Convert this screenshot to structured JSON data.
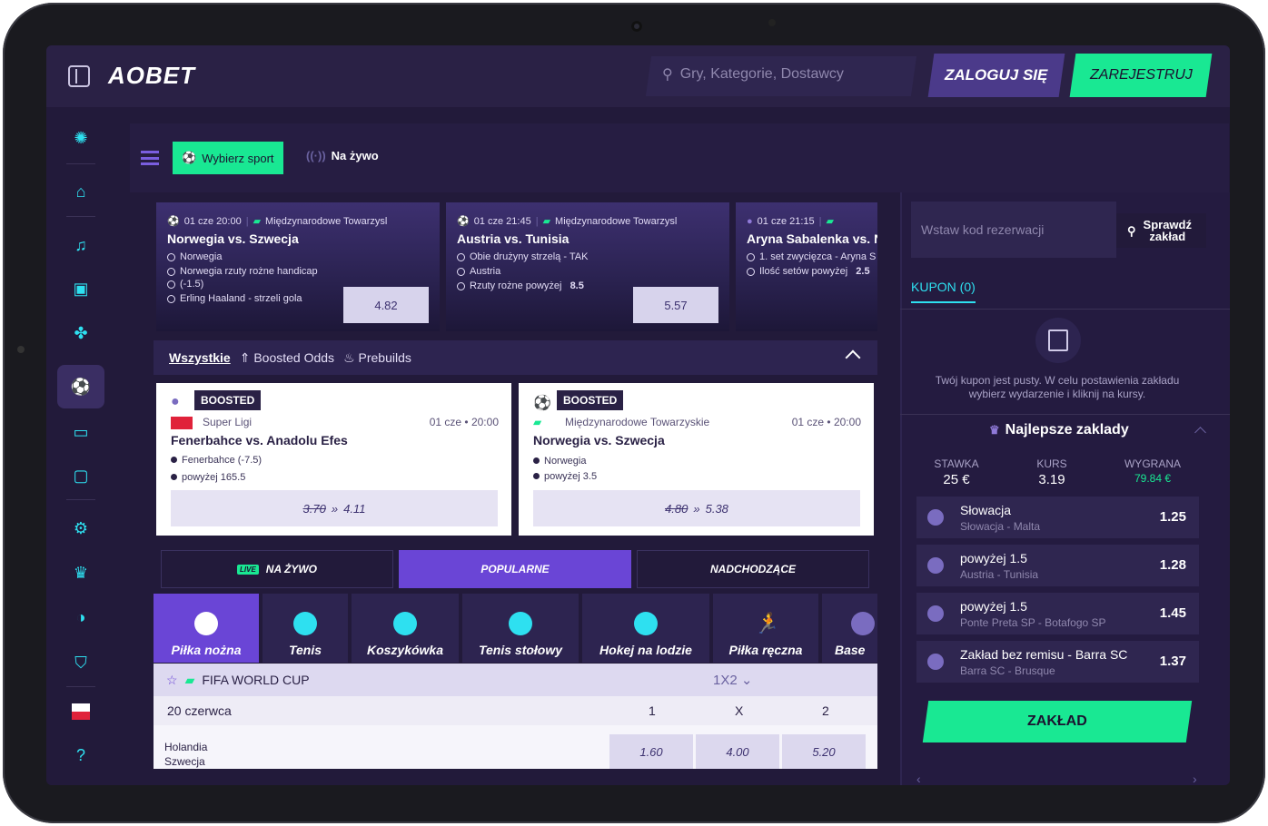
{
  "header": {
    "logo": "AOBET",
    "search_placeholder": "Gry, Kategorie, Dostawcy",
    "login_label": "ZALOGUJ SIĘ",
    "register_label": "ZAREJESTRUJ"
  },
  "leftnav": {
    "icons": [
      "promo-icon",
      "home-icon",
      "music-icon",
      "slots-icon",
      "clover-icon",
      "sports-icon",
      "live-icon",
      "tv-icon",
      "settings-icon",
      "trophy-icon",
      "ball-icon",
      "shop-icon",
      "flag-pl-icon",
      "help-icon"
    ]
  },
  "subbar": {
    "select_sport": "Wybierz sport",
    "live": "Na żywo"
  },
  "top_cards": [
    {
      "date": "01 cze 20:00",
      "league": "Międzynarodowe Towarzysl",
      "title": "Norwegia vs. Szwecja",
      "selections": [
        "Norwegia",
        "Norwegia rzuty rożne handicap",
        "(-1.5)",
        "Erling Haaland - strzeli gola"
      ],
      "odds": "4.82"
    },
    {
      "date": "01 cze 21:45",
      "league": "Międzynarodowe Towarzysl",
      "title": "Austria vs. Tunisia",
      "selections": [
        "Obie drużyny strzelą - TAK",
        "Austria",
        "Rzuty rożne powyżej",
        "8.5"
      ],
      "odds": "5.57"
    },
    {
      "date": "01 cze 21:15",
      "title": "Aryna Sabalenka vs. N",
      "selections": [
        "1. set zwycięzca - Aryna S",
        "Ilość setów powyżej",
        "2.5"
      ]
    }
  ],
  "filters": {
    "all": "Wszystkie",
    "boosted": "Boosted Odds",
    "prebuilds": "Prebuilds"
  },
  "boosted_cards": [
    {
      "badge": "BOOSTED",
      "league": "Super Ligi",
      "date": "01 cze • 20:00",
      "match": "Fenerbahce vs. Anadolu Efes",
      "legs": [
        "Fenerbahce (-7.5)",
        "powyżej 165.5"
      ],
      "old_odds": "3.70",
      "new_odds": "4.11"
    },
    {
      "badge": "BOOSTED",
      "league": "Międzynarodowe Towarzyskie",
      "date": "01 cze • 20:00",
      "match": "Norwegia vs. Szwecja",
      "legs": [
        "Norwegia",
        "powyżej 3.5"
      ],
      "old_odds": "4.80",
      "new_odds": "5.38"
    }
  ],
  "main_tabs": {
    "live_badge": "LIVE",
    "live": "NA ŻYWO",
    "popular": "POPULARNE",
    "upcoming": "NADCHODZĄCE"
  },
  "sport_tabs": [
    "Piłka nożna",
    "Tenis",
    "Koszykówka",
    "Tenis stołowy",
    "Hokej na lodzie",
    "Piłka ręczna",
    "Base"
  ],
  "event_list": {
    "competition": "FIFA WORLD CUP",
    "market": "1X2",
    "date": "20 czerwca",
    "headers": [
      "1",
      "X",
      "2"
    ],
    "match": {
      "home": "Holandia",
      "away": "Szwecja",
      "odds": [
        "1.60",
        "4.00",
        "5.20"
      ]
    }
  },
  "betslip": {
    "code_placeholder": "Wstaw kod rezerwacji",
    "check_btn_line1": "Sprawdź",
    "check_btn_line2": "zakład",
    "tab": "KUPON (0)",
    "empty_text": "Twój kupon jest pusty. W celu postawienia zakładu wybierz wydarzenie i kliknij na kursy.",
    "top_title": "Najlepsze zaklady",
    "stats": [
      {
        "label": "STAWKA",
        "value": "25 €"
      },
      {
        "label": "KURS",
        "value": "3.19"
      },
      {
        "label": "WYGRANA",
        "value": "79.84 €"
      }
    ],
    "bets": [
      {
        "selection": "Słowacja",
        "event": "Słowacja - Malta",
        "odds": "1.25"
      },
      {
        "selection": "powyżej 1.5",
        "event": "Austria - Tunisia",
        "odds": "1.28"
      },
      {
        "selection": "powyżej 1.5",
        "event": "Ponte Preta SP - Botafogo SP",
        "odds": "1.45"
      },
      {
        "selection": "Zakład bez remisu - Barra SC",
        "event": "Barra SC - Brusque",
        "odds": "1.37"
      }
    ],
    "bet_button": "ZAKŁAD"
  },
  "colors": {
    "accent_green": "#19e893",
    "accent_purple": "#6a45d6",
    "bg": "#221a3a",
    "cyan": "#2ee0f0"
  }
}
